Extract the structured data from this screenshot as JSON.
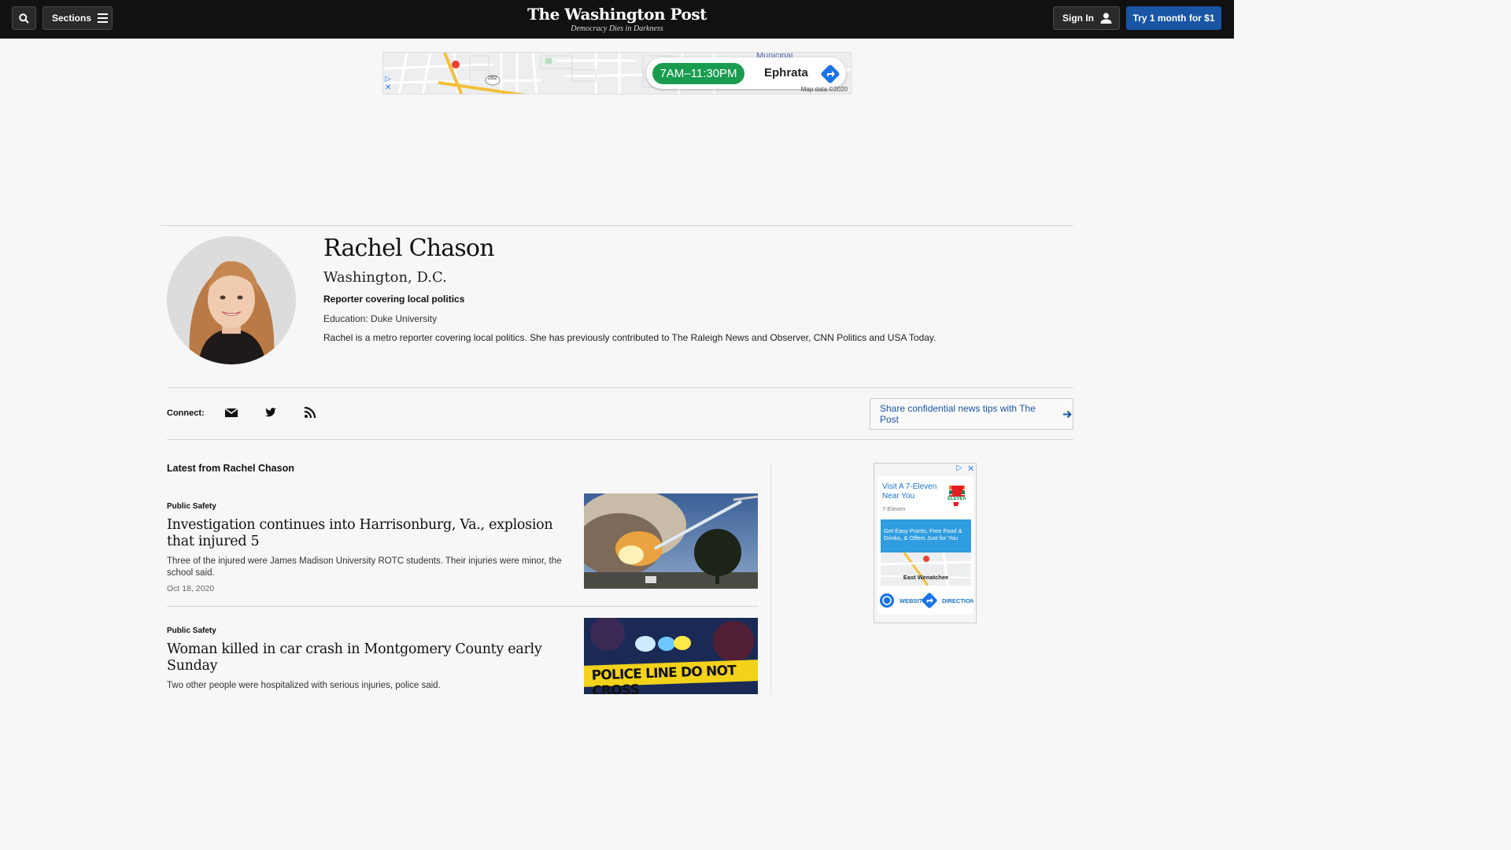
{
  "header": {
    "sections_label": "Sections",
    "logo": "The Washington Post",
    "tagline": "Democracy Dies in Darkness",
    "signin_label": "Sign In",
    "try_label": "Try 1 month for $1"
  },
  "top_ad": {
    "hours": "7AM–11:30PM",
    "city": "Ephrata",
    "map_label": "Municipal",
    "map_data": "Map data ©2020",
    "route_number": "282"
  },
  "author": {
    "name": "Rachel Chason",
    "location": "Washington, D.C.",
    "role": "Reporter covering local politics",
    "education": "Education: Duke University",
    "bio": "Rachel is a metro reporter covering local politics. She has previously contributed to The Raleigh News and Observer, CNN Politics and USA Today."
  },
  "connect": {
    "label": "Connect:",
    "icons": [
      "email-icon",
      "twitter-icon",
      "rss-icon"
    ],
    "tips_label": "Share confidential news tips with The Post"
  },
  "latest": {
    "heading": "Latest from Rachel Chason",
    "articles": [
      {
        "kicker": "Public Safety",
        "headline": "Investigation continues into Harrisonburg, Va., explosion that injured 5",
        "blurb": "Three of the injured were James Madison University ROTC students. Their injuries were minor, the school said.",
        "date": "Oct 18, 2020"
      },
      {
        "kicker": "Public Safety",
        "headline": "Woman killed in car crash in Montgomery County early Sunday",
        "blurb": "Two other people were hospitalized with serious injuries, police said.",
        "thumb_text": "POLICE LINE DO NOT CROSS"
      }
    ]
  },
  "side_ad": {
    "title": "Visit A 7-Eleven Near You",
    "brand": "7-Eleven",
    "logo_text": "ELEVEn",
    "promo": "Get Easy Points, Free Food & Drinks, & Offers Just for You",
    "city": "East Wenatchee",
    "website_label": "WEBSITE",
    "directions_label": "DIRECTIONS"
  },
  "colors": {
    "accent": "#1955a5",
    "topbar": "#111111",
    "ad_green": "#1a9c50"
  }
}
